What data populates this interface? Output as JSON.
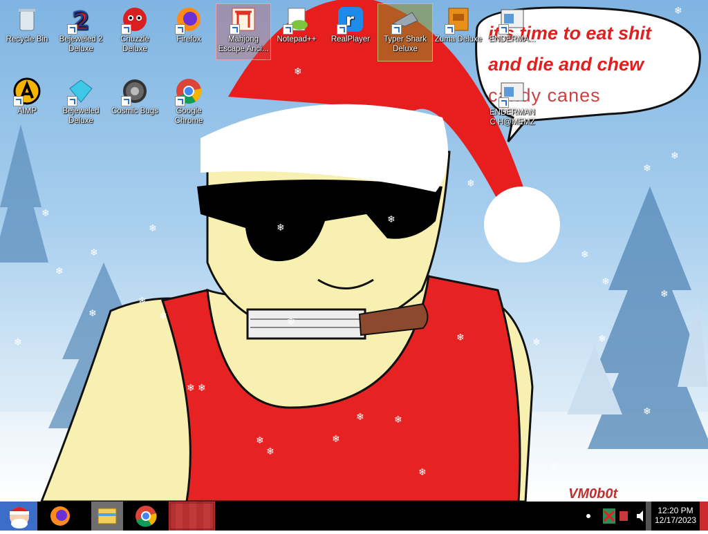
{
  "desktop": {
    "icons": [
      {
        "label": "Recycle Bin",
        "icon": "recycle-bin-icon"
      },
      {
        "label": "Bejeweled 2 Deluxe",
        "icon": "bejeweled2-icon"
      },
      {
        "label": "Chuzzle Deluxe",
        "icon": "chuzzle-icon"
      },
      {
        "label": "Firefox",
        "icon": "firefox-icon"
      },
      {
        "label": "Mahjong Escape Anci...",
        "icon": "mahjong-icon"
      },
      {
        "label": "Notepad++",
        "icon": "notepadpp-icon"
      },
      {
        "label": "RealPlayer",
        "icon": "realplayer-icon"
      },
      {
        "label": "Typer Shark Deluxe",
        "icon": "typer-shark-icon"
      },
      {
        "label": "Zuma Deluxe",
        "icon": "zuma-icon"
      },
      {
        "label": "ENDERMA...",
        "icon": "enderman-icon"
      },
      {
        "label": "AIMP",
        "icon": "aimp-icon"
      },
      {
        "label": "Bejeweled Deluxe",
        "icon": "bejeweled-icon"
      },
      {
        "label": "Cosmic Bugs",
        "icon": "cosmic-bugs-icon"
      },
      {
        "label": "Google Chrome",
        "icon": "chrome-icon"
      },
      {
        "label": "ENDERMANC H@MEMZ",
        "icon": "enderman-icon"
      }
    ]
  },
  "wallpaper": {
    "speech_line1": "it's time to eat shit",
    "speech_line2": "and die and chew",
    "speech_line3": "candy canes",
    "signature": "VM0b0t"
  },
  "taskbar": {
    "apps": [
      "start-santa-icon",
      "firefox-icon",
      "file-explorer-icon",
      "chrome-icon",
      "active-window-thumbnail"
    ],
    "clock_time": "12:20 PM",
    "clock_date": "12/17/2023",
    "colors": {
      "background": "#000000",
      "accent": "#cc2a2a"
    }
  }
}
